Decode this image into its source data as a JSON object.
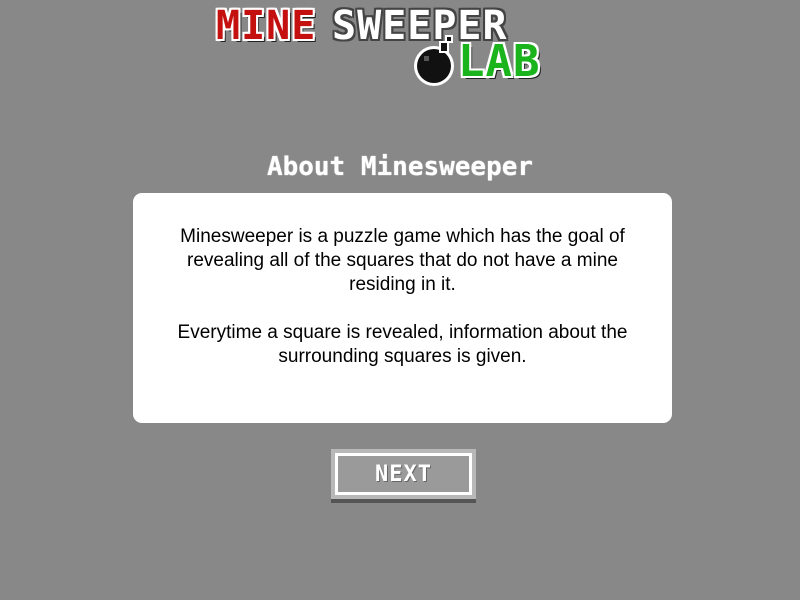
{
  "logo": {
    "word_mine": "Mine",
    "word_sweeper": "sweeper",
    "word_lab": "Lab",
    "icon": "bomb-icon",
    "colors": {
      "mine": "#c51010",
      "sweeper": "#ffffff",
      "lab": "#1cb41c"
    }
  },
  "heading": "About Minesweeper",
  "panel": {
    "paragraphs": [
      "Minesweeper is a puzzle game which has the goal of revealing all of the squares that do not have a mine residing in it.",
      "Everytime a square is revealed, information about the surrounding squares is given."
    ]
  },
  "next_button": {
    "label": "Next"
  },
  "colors": {
    "background": "#888888",
    "panel": "#ffffff",
    "button_face": "#9a9a9a"
  }
}
